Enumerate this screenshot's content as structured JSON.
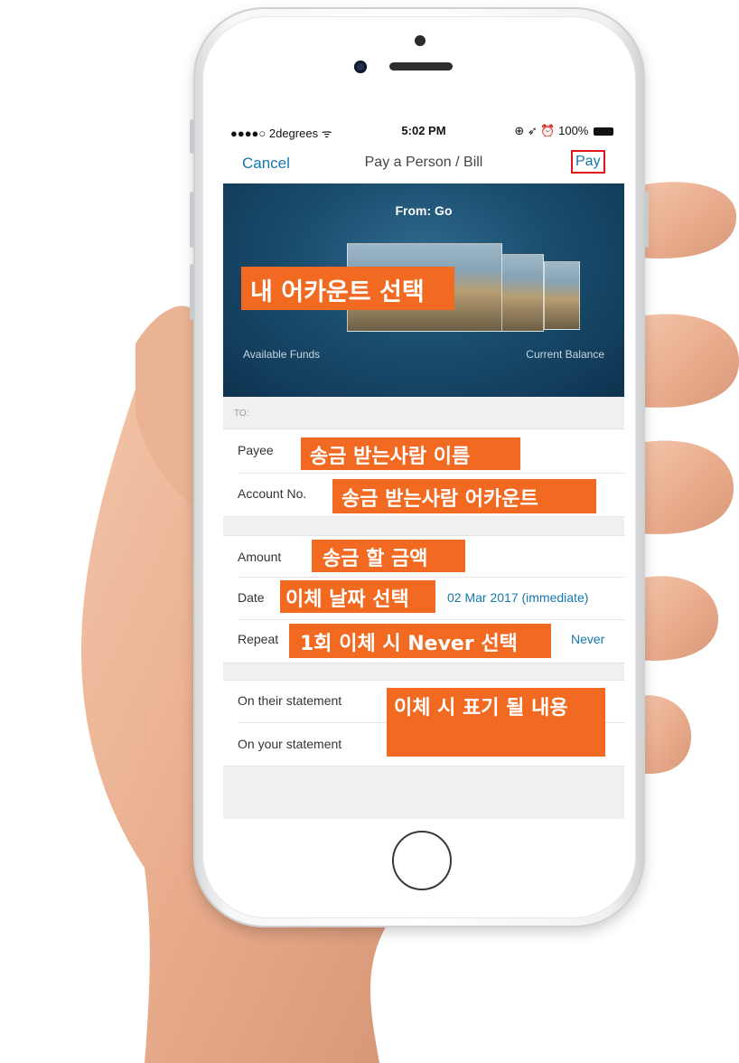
{
  "status_bar": {
    "carrier": "●●●●○ 2degrees ᯤ",
    "time": "5:02 PM",
    "right": "⊕ ➶ ⏰ 100%"
  },
  "nav": {
    "cancel": "Cancel",
    "title": "Pay a Person / Bill",
    "pay": "Pay"
  },
  "hero": {
    "from": "From: Go",
    "available_funds": "Available Funds",
    "current_balance": "Current Balance"
  },
  "to_section": {
    "label": "TO:"
  },
  "payee_group": {
    "payee_label": "Payee",
    "account_label": "Account No."
  },
  "payment_group": {
    "amount_label": "Amount",
    "date_label": "Date",
    "date_value": "02 Mar 2017 (immediate)",
    "repeat_label": "Repeat",
    "repeat_value": "Never"
  },
  "statement_group": {
    "their_label": "On their statement",
    "your_label": "On your statement"
  },
  "annotations": {
    "account_select": "내 어카운트 선택",
    "payee_name": "송금 받는사람 이름",
    "payee_account": "송금 받는사람 어카운트",
    "amount": "송금 할 금액",
    "date_select": "이체 날짜 선택",
    "repeat_never": "1회 이체 시 Never 선택",
    "statement_text": "이체 시 표기 될 내용"
  },
  "colors": {
    "accent": "#1478b0",
    "annotation": "#f26a21",
    "highlight_border": "#e0161b",
    "hero_bg": "#1a4d6e"
  }
}
